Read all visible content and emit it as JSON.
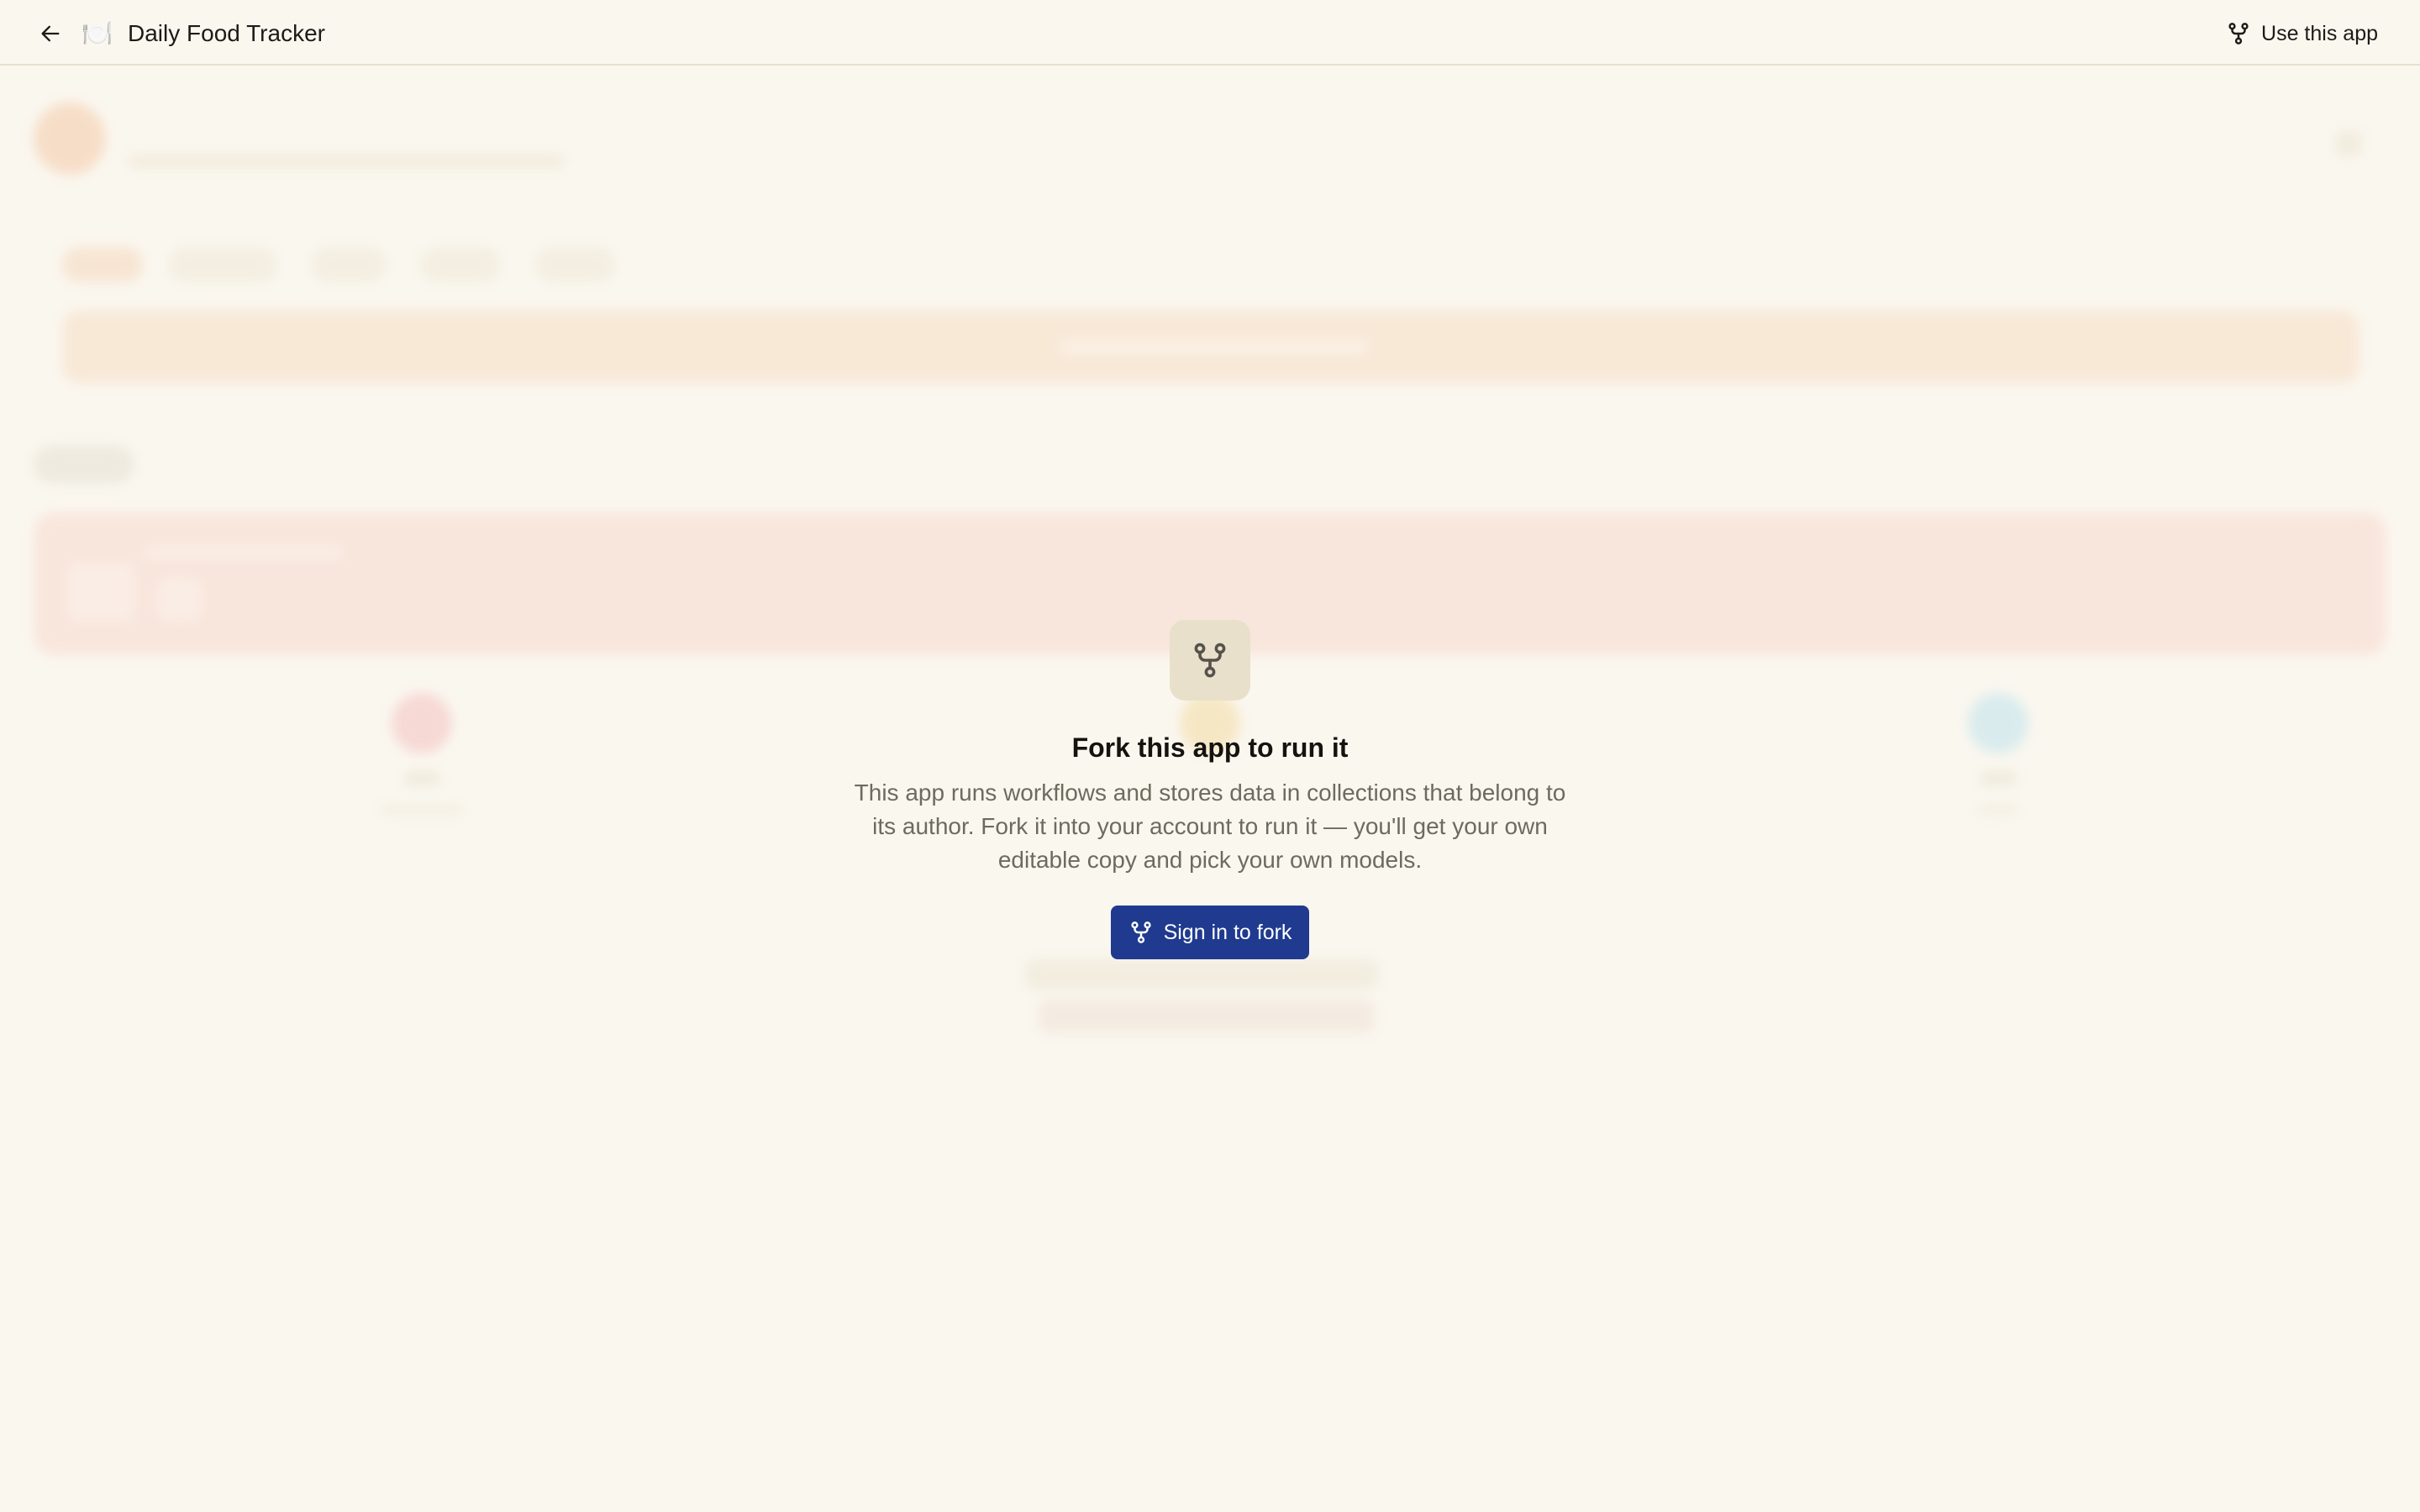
{
  "topbar": {
    "app_emoji": "🍽️",
    "app_title": "Daily Food Tracker",
    "use_app_label": "Use this app"
  },
  "icons": {
    "back": "arrow-left-icon",
    "fork": "fork-icon"
  },
  "modal": {
    "heading": "Fork this app to run it",
    "description": "This app runs workflows and stores data in collections that belong to its author. Fork it into your account to run it — you'll get your own editable copy and pick your own models.",
    "sign_in_label": "Sign in to fork"
  },
  "colors": {
    "background": "#faf7ef",
    "primary_button": "#1f3a8f",
    "icon_tile": "#e8e0cb"
  }
}
